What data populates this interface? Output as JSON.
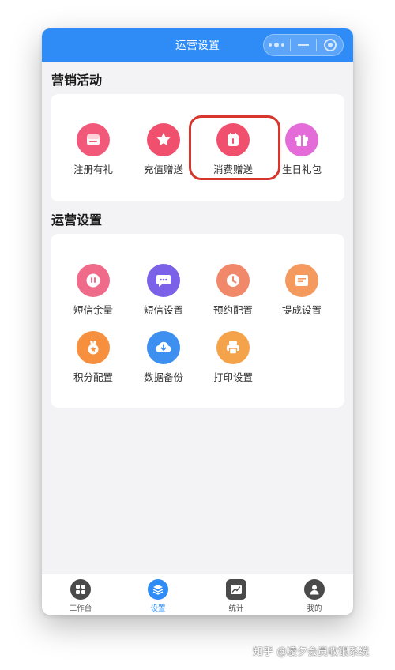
{
  "navbar": {
    "title": "运营设置"
  },
  "marketing": {
    "title": "营销活动",
    "items": [
      {
        "label": "注册有礼",
        "icon": "register-gift-icon",
        "color": "#f2587a"
      },
      {
        "label": "充值赠送",
        "icon": "star-badge-icon",
        "color": "#f0506e"
      },
      {
        "label": "消费赠送",
        "icon": "calendar-gift-icon",
        "color": "#f0506e"
      },
      {
        "label": "生日礼包",
        "icon": "gift-box-icon",
        "color": "#e46cd8"
      }
    ]
  },
  "operations": {
    "title": "运营设置",
    "items": [
      {
        "label": "短信余量",
        "icon": "sms-balance-icon",
        "color": "#f06a8a"
      },
      {
        "label": "短信设置",
        "icon": "message-icon",
        "color": "#7b61e8"
      },
      {
        "label": "预约配置",
        "icon": "clock-icon",
        "color": "#f2886a"
      },
      {
        "label": "提成设置",
        "icon": "commission-list-icon",
        "color": "#f59a5e"
      },
      {
        "label": "积分配置",
        "icon": "medal-icon",
        "color": "#f6903f"
      },
      {
        "label": "数据备份",
        "icon": "cloud-download-icon",
        "color": "#3d8ff0"
      },
      {
        "label": "打印设置",
        "icon": "printer-icon",
        "color": "#f5a34a"
      }
    ]
  },
  "tabbar": {
    "tabs": [
      {
        "label": "工作台",
        "icon": "grid-icon",
        "active": false
      },
      {
        "label": "设置",
        "icon": "layers-icon",
        "active": true
      },
      {
        "label": "统计",
        "icon": "chart-icon",
        "active": false
      },
      {
        "label": "我的",
        "icon": "user-icon",
        "active": false
      }
    ]
  },
  "watermark": {
    "text": "知乎 @凌夕会员收银系统"
  },
  "colors": {
    "primary": "#2f8cf6",
    "highlight": "#d6362c",
    "background": "#f3f3f5"
  }
}
